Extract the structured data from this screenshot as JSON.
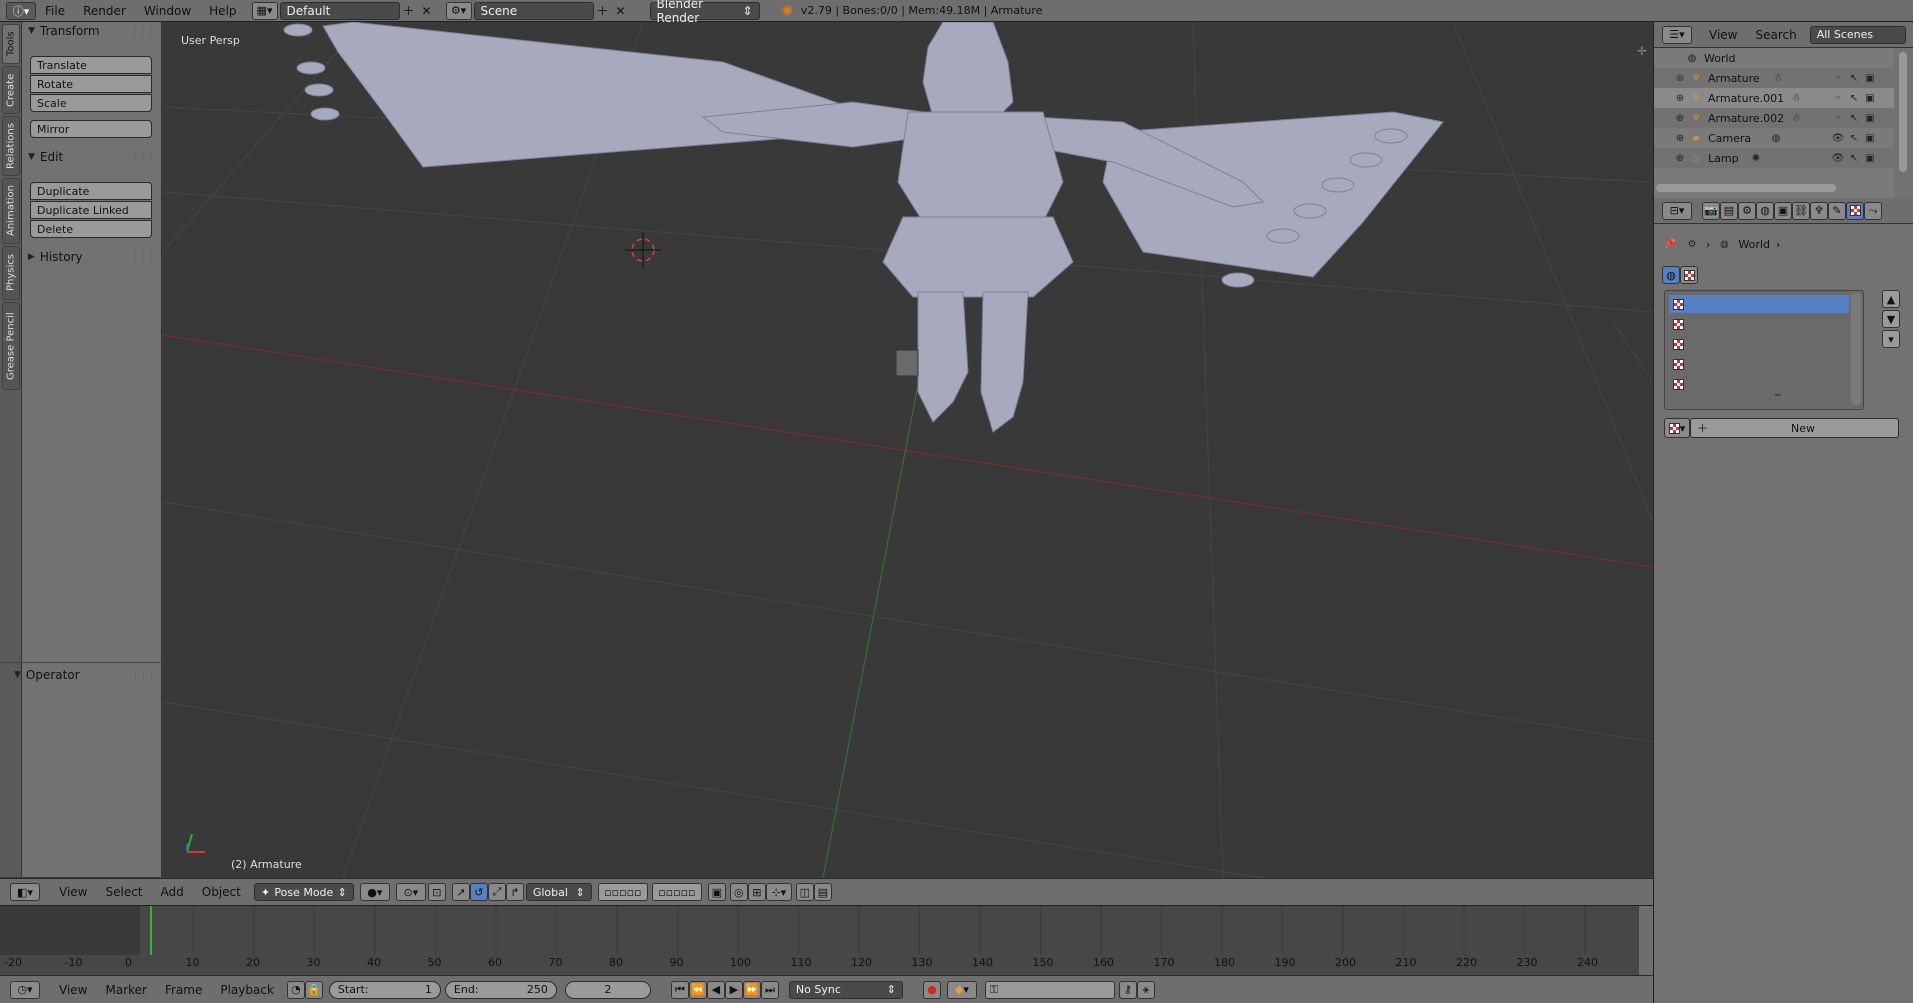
{
  "topbar": {
    "menus": [
      "File",
      "Render",
      "Window",
      "Help"
    ],
    "screen_layout": "Default",
    "scene": "Scene",
    "render_engine": "Blender Render",
    "stats": "v2.79 | Bones:0/0 | Mem:49.18M | Armature"
  },
  "tool_tabs": [
    "Tools",
    "Create",
    "Relations",
    "Animation",
    "Physics",
    "Grease Pencil"
  ],
  "toolshelf": {
    "transform_label": "Transform",
    "transform_buttons": [
      "Translate",
      "Rotate",
      "Scale"
    ],
    "mirror": "Mirror",
    "edit_label": "Edit",
    "edit_buttons": [
      "Duplicate",
      "Duplicate Linked",
      "Delete"
    ],
    "history_label": "History",
    "operator_label": "Operator"
  },
  "viewport": {
    "view_label": "User Persp",
    "object_label": "(2) Armature"
  },
  "view3d_header": {
    "menus": [
      "View",
      "Select",
      "Add",
      "Object"
    ],
    "mode": "Pose Mode",
    "orientation": "Global"
  },
  "timeline": {
    "ruler": [
      "-20",
      "-10",
      "0",
      "10",
      "20",
      "30",
      "40",
      "50",
      "60",
      "70",
      "80",
      "90",
      "100",
      "110",
      "120",
      "130",
      "140",
      "150",
      "160",
      "170",
      "180",
      "190",
      "200",
      "210",
      "220",
      "230",
      "240"
    ],
    "menus": [
      "View",
      "Marker",
      "Frame",
      "Playback"
    ],
    "start_label": "Start:",
    "start_value": "1",
    "end_label": "End:",
    "end_value": "250",
    "current_frame": "2",
    "sync": "No Sync"
  },
  "outliner": {
    "menus": [
      "View",
      "Search"
    ],
    "filter": "All Scenes",
    "rows": [
      "World",
      "Armature",
      "Armature.001",
      "Armature.002",
      "Camera",
      "Lamp"
    ]
  },
  "properties": {
    "context": "World",
    "new_button": "New"
  },
  "colors": {
    "accent_blue": "#5680c2",
    "x_axis": "#8a2a2a",
    "y_axis": "#2f7a2f",
    "selection_orange": "#f0a030"
  }
}
